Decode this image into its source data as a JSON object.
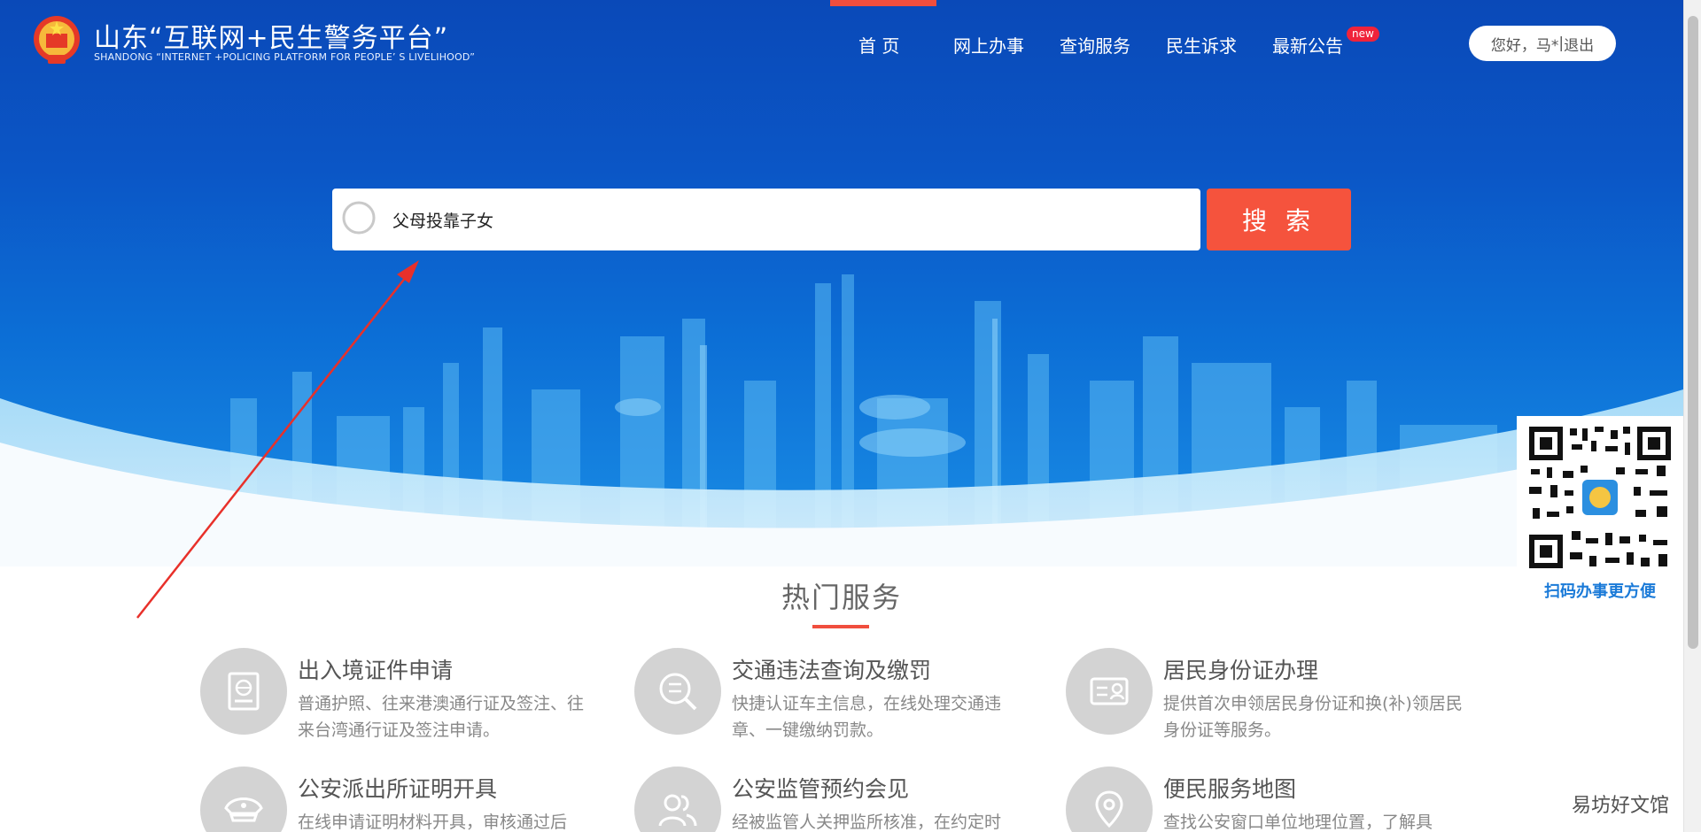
{
  "header": {
    "site_title": "山东“互联网+民生警务平台”",
    "site_subtitle": "SHANDONG “INTERNET +POLICING PLATFORM FOR PEOPLE’ S LIVELIHOOD”",
    "nav": [
      {
        "label": "首 页",
        "active": true
      },
      {
        "label": "网上办事"
      },
      {
        "label": "查询服务"
      },
      {
        "label": "民生诉求"
      },
      {
        "label": "最新公告",
        "badge": "new"
      }
    ],
    "user": {
      "greeting": "您好，马*",
      "separator": " | ",
      "logout": "退出"
    }
  },
  "search": {
    "value": "父母投靠子女",
    "button_label": "搜 索"
  },
  "qr": {
    "caption": "扫码办事更方便"
  },
  "hot_services": {
    "title": "热门服务",
    "items": [
      {
        "title": "出入境证件申请",
        "desc": "普通护照、往来港澳通行证及签注、往来台湾通行证及签注申请。",
        "icon": "passport-icon"
      },
      {
        "title": "交通违法查询及缴罚",
        "desc": "快捷认证车主信息，在线处理交通违章、一键缴纳罚款。",
        "icon": "violation-search-icon"
      },
      {
        "title": "居民身份证办理",
        "desc": "提供首次申领居民身份证和换(补)领居民身份证等服务。",
        "icon": "id-card-icon"
      },
      {
        "title": "公安派出所证明开具",
        "desc": "在线申请证明材料开具，审核通过后",
        "icon": "police-cap-icon"
      },
      {
        "title": "公安监管预约会见",
        "desc": "经被监管人关押监所核准，在约定时",
        "icon": "people-icon"
      },
      {
        "title": "便民服务地图",
        "desc": "查找公安窗口单位地理位置，了解具",
        "icon": "map-pin-icon"
      }
    ]
  },
  "watermark": "易坊好文馆",
  "colors": {
    "brand_blue": "#0b56c6",
    "accent_red": "#f5533d",
    "qr_caption": "#1a7ad8"
  }
}
